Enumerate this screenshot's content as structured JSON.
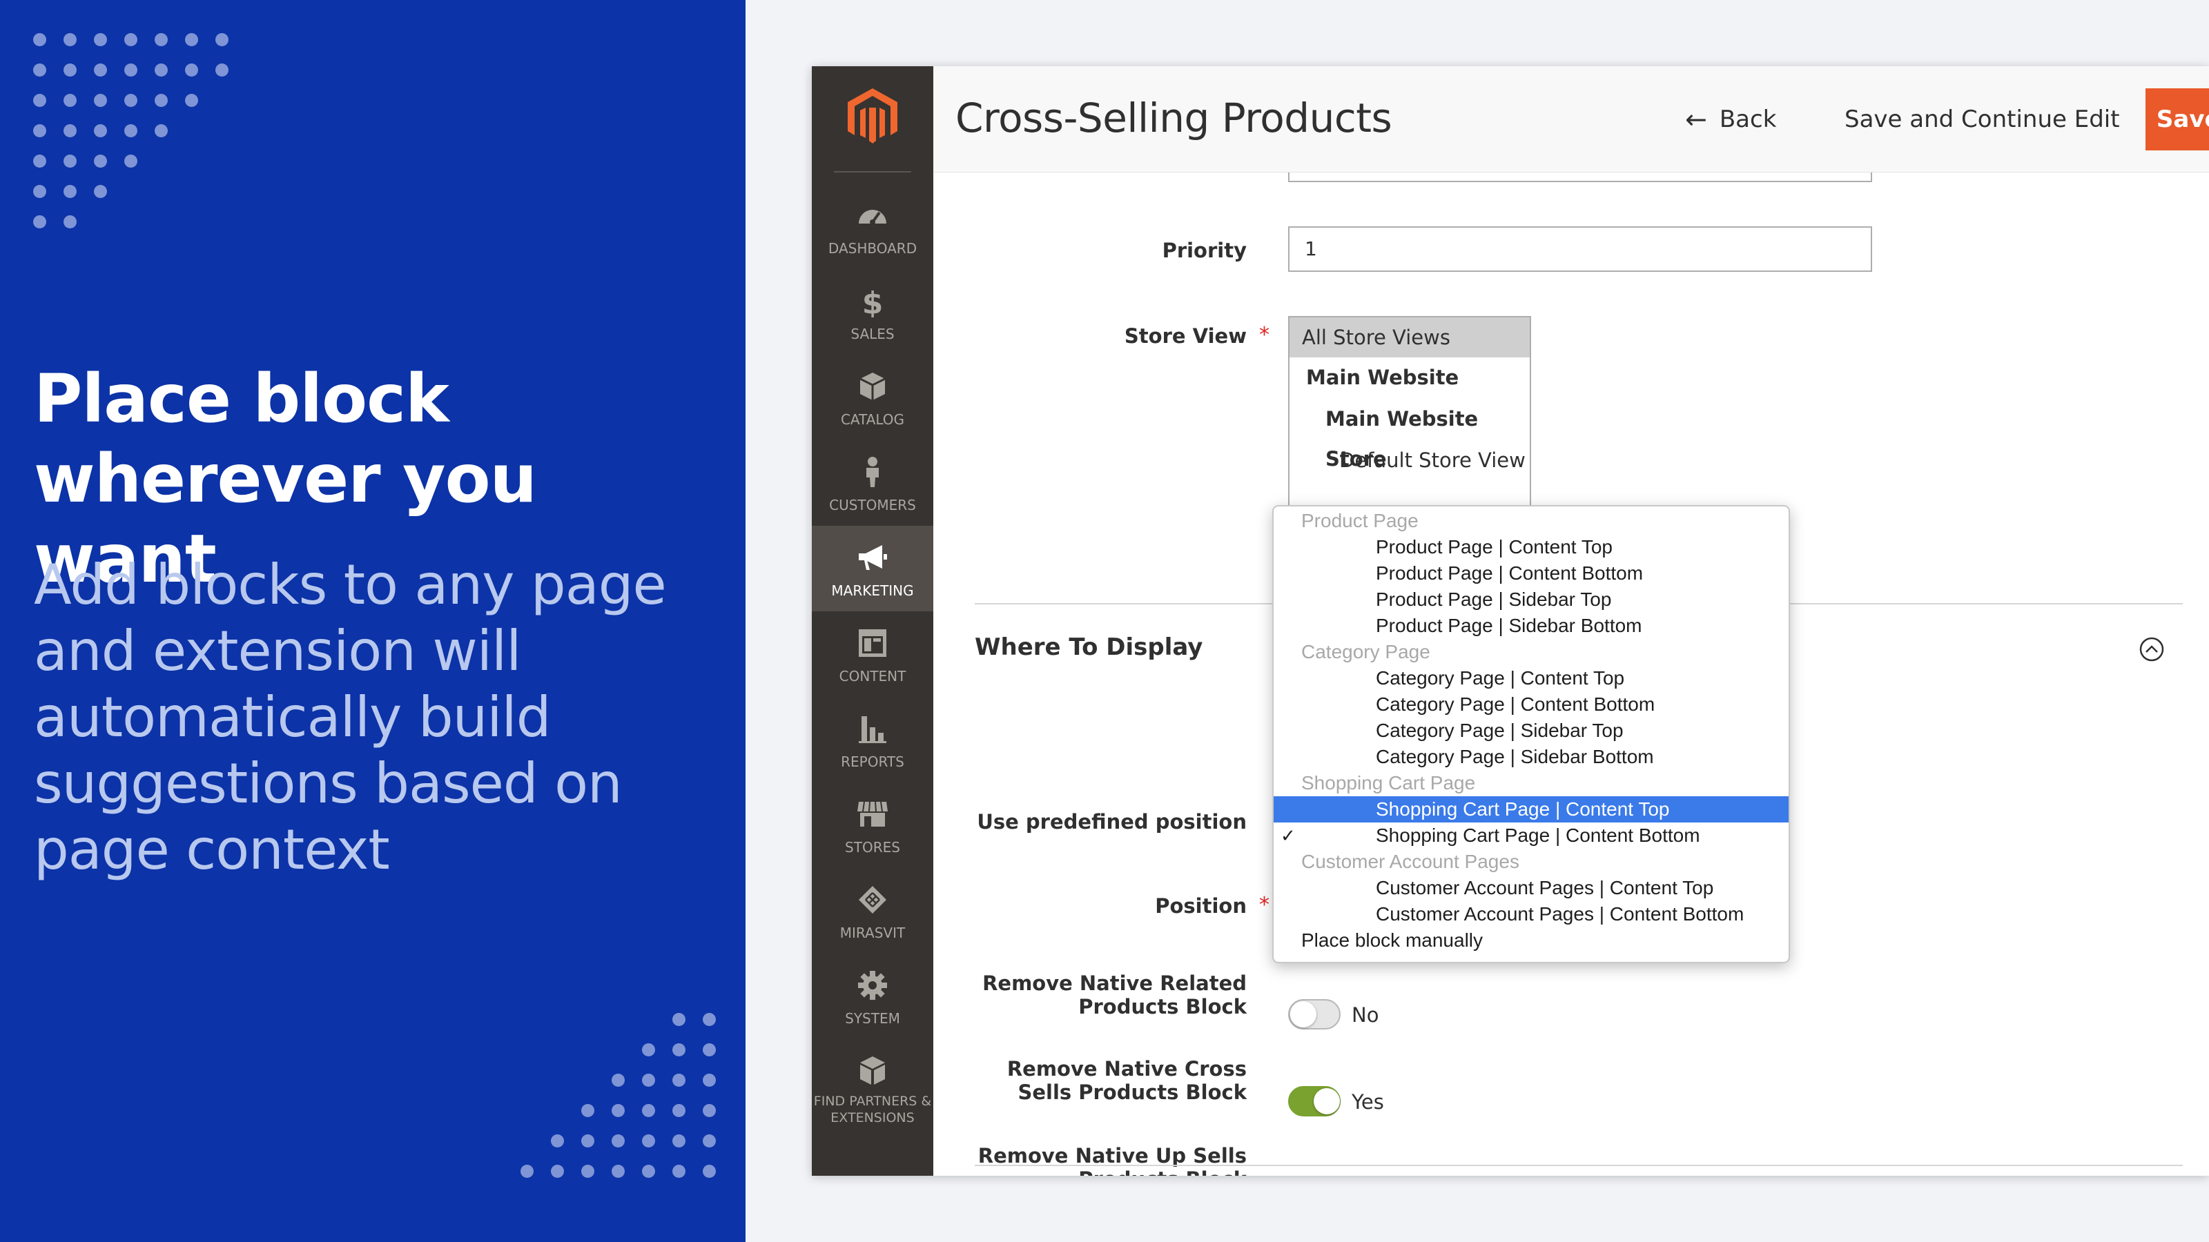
{
  "promo": {
    "title": "Place block wherever you want",
    "subtitle": "Add blocks to any page and extension will automatically build suggestions based on page context",
    "bg_color": "#0c33a7"
  },
  "sidebar": {
    "items": [
      {
        "label": "DASHBOARD",
        "icon": "dashboard-icon"
      },
      {
        "label": "SALES",
        "icon": "dollar-icon"
      },
      {
        "label": "CATALOG",
        "icon": "box-icon"
      },
      {
        "label": "CUSTOMERS",
        "icon": "person-icon"
      },
      {
        "label": "MARKETING",
        "icon": "megaphone-icon",
        "active": true
      },
      {
        "label": "CONTENT",
        "icon": "layout-icon"
      },
      {
        "label": "REPORTS",
        "icon": "bar-chart-icon"
      },
      {
        "label": "STORES",
        "icon": "storefront-icon"
      },
      {
        "label": "MIRASVIT",
        "icon": "mirasvit-icon"
      },
      {
        "label": "SYSTEM",
        "icon": "gear-icon"
      },
      {
        "label": "FIND PARTNERS & EXTENSIONS",
        "icon": "cubes-icon"
      }
    ]
  },
  "header": {
    "title": "Cross-Selling Products",
    "back_label": "Back",
    "save_continue_label": "Save and Continue Edit",
    "save_label": "Save Block",
    "accent_color": "#e9592a"
  },
  "form": {
    "priority_label": "Priority",
    "priority_value": "1",
    "store_view_label": "Store View",
    "store_views": [
      {
        "label": "All Store Views",
        "selected": true
      },
      {
        "label": "Main Website"
      },
      {
        "label": "Main Website Store"
      },
      {
        "label": "Default Store View"
      }
    ],
    "section_title": "Where To Display",
    "predefined_label": "Use predefined position",
    "position_label": "Position",
    "remove_related_label": "Remove Native Related Products Block",
    "remove_cross_label": "Remove Native Cross Sells Products Block",
    "remove_cross_value": "No",
    "remove_cross_on": false,
    "remove_up_label": "Remove Native Up Sells Products Block",
    "remove_up_value": "Yes",
    "remove_up_on": true
  },
  "dropdown": {
    "items": [
      {
        "type": "group",
        "label": "Product Page"
      },
      {
        "type": "option",
        "label": "Product Page | Content Top"
      },
      {
        "type": "option",
        "label": "Product Page | Content Bottom"
      },
      {
        "type": "option",
        "label": "Product Page | Sidebar Top"
      },
      {
        "type": "option",
        "label": "Product Page | Sidebar Bottom"
      },
      {
        "type": "group",
        "label": "Category Page"
      },
      {
        "type": "option",
        "label": "Category Page | Content Top"
      },
      {
        "type": "option",
        "label": "Category Page | Content Bottom"
      },
      {
        "type": "option",
        "label": "Category Page | Sidebar Top"
      },
      {
        "type": "option",
        "label": "Category Page | Sidebar Bottom"
      },
      {
        "type": "group",
        "label": "Shopping Cart Page"
      },
      {
        "type": "option",
        "label": "Shopping Cart Page | Content Top",
        "highlighted": true
      },
      {
        "type": "option",
        "label": "Shopping Cart Page | Content Bottom",
        "checked": true
      },
      {
        "type": "group",
        "label": "Customer Account Pages"
      },
      {
        "type": "option",
        "label": "Customer Account Pages | Content Top"
      },
      {
        "type": "option",
        "label": "Customer Account Pages | Content Bottom"
      },
      {
        "type": "manual",
        "label": "Place block manually"
      }
    ],
    "highlight_color": "#3a7ae9"
  }
}
